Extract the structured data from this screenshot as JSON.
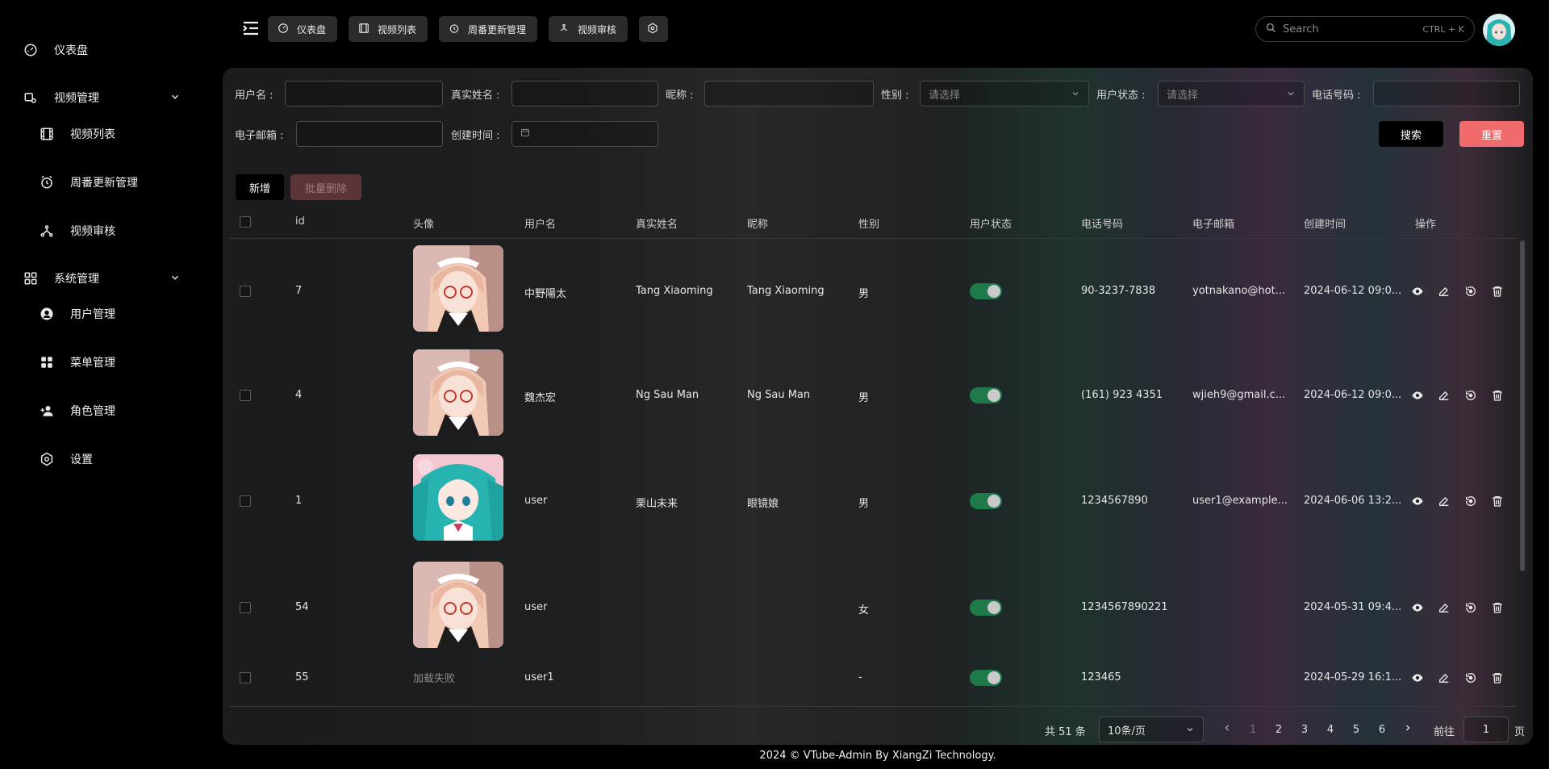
{
  "sidebar": {
    "dashboard": "仪表盘",
    "video_mgmt": "视频管理",
    "video_list": "视频列表",
    "weekly_update": "周番更新管理",
    "video_review": "视频审核",
    "system_mgmt": "系统管理",
    "user_mgmt": "用户管理",
    "menu_mgmt": "菜单管理",
    "role_mgmt": "角色管理",
    "settings": "设置"
  },
  "header": {
    "tabs": [
      "仪表盘",
      "视频列表",
      "周番更新管理",
      "视频审核"
    ],
    "search_placeholder": "Search",
    "search_shortcut": "CTRL + K"
  },
  "filters": {
    "username_label": "用户名 :",
    "realname_label": "真实姓名 :",
    "nickname_label": "昵称 :",
    "gender_label": "性别 :",
    "gender_placeholder": "请选择",
    "status_label": "用户状态 :",
    "status_placeholder": "请选择",
    "phone_label": "电话号码 :",
    "email_label": "电子邮箱 :",
    "created_label": "创建时间 :",
    "search_btn": "搜索",
    "reset_btn": "重置"
  },
  "toolbar": {
    "add_btn": "新增",
    "batch_delete_btn": "批量删除"
  },
  "table": {
    "columns": [
      "id",
      "头像",
      "用户名",
      "真实姓名",
      "昵称",
      "性别",
      "用户状态",
      "电话号码",
      "电子邮箱",
      "创建时间",
      "操作"
    ],
    "rows": [
      {
        "id": "7",
        "username": "中野陽太",
        "realname": "Tang Xiaoming",
        "nickname": "Tang Xiaoming",
        "gender": "男",
        "enabled": true,
        "phone": "90-3237-7838",
        "email": "yotnakano@hot...",
        "created": "2024-06-12 09:0...",
        "avatar": "maid"
      },
      {
        "id": "4",
        "username": "魏杰宏",
        "realname": "Ng Sau Man",
        "nickname": "Ng Sau Man",
        "gender": "男",
        "enabled": true,
        "phone": "(161) 923 4351",
        "email": "wjieh9@gmail.c...",
        "created": "2024-06-12 09:0...",
        "avatar": "maid"
      },
      {
        "id": "1",
        "username": "user",
        "realname": "栗山未来",
        "nickname": "眼镜娘",
        "gender": "男",
        "enabled": true,
        "phone": "1234567890",
        "email": "user1@example...",
        "created": "2024-06-06 13:2...",
        "avatar": "miku"
      },
      {
        "id": "54",
        "username": "user",
        "realname": "",
        "nickname": "",
        "gender": "女",
        "enabled": true,
        "phone": "1234567890221",
        "email": "",
        "created": "2024-05-31 09:4...",
        "avatar": "maid"
      },
      {
        "id": "55",
        "username": "user1",
        "realname": "",
        "nickname": "",
        "gender": "-",
        "enabled": true,
        "phone": "123465",
        "email": "",
        "created": "2024-05-29 16:1...",
        "avatar_text": "加载失败"
      }
    ]
  },
  "pagination": {
    "total_text": "共 51 条",
    "page_size": "10条/页",
    "pages": [
      "1",
      "2",
      "3",
      "4",
      "5",
      "6"
    ],
    "current_page": "1",
    "goto_label": "前往",
    "goto_value": "1",
    "page_suffix": "页"
  },
  "footer": {
    "text": "2024 © VTube-Admin By XiangZi Technology."
  },
  "colors": {
    "accent_red": "#f06c6c",
    "switch_on": "#1f7a4a",
    "search_button": "#000000"
  }
}
